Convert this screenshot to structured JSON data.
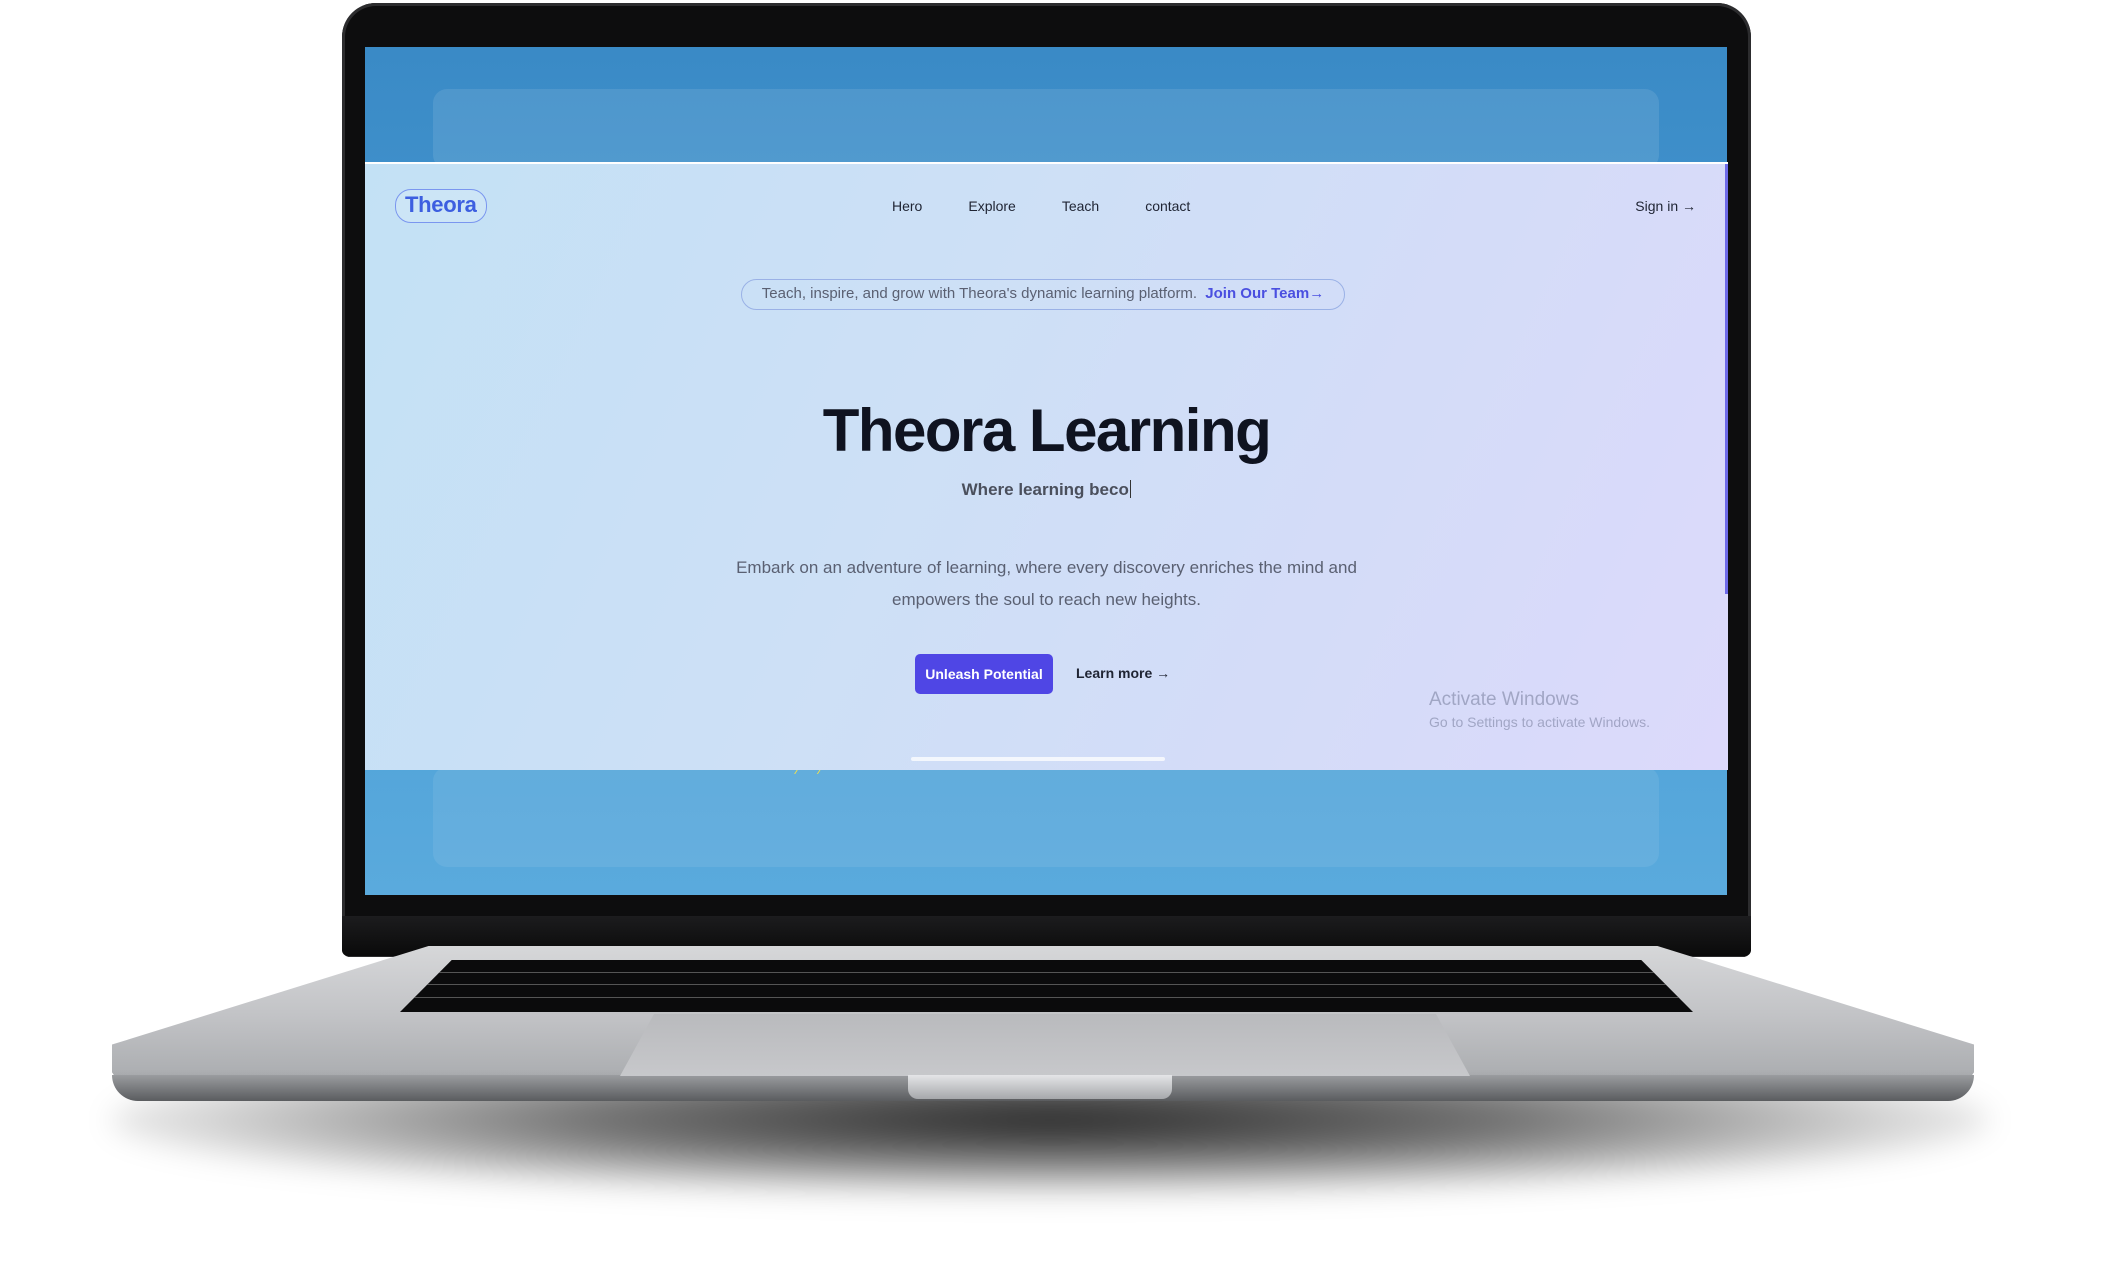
{
  "site": {
    "logo": "Theora",
    "nav": [
      "Hero",
      "Explore",
      "Teach",
      "contact"
    ],
    "sign_in": "Sign in →",
    "announcement": {
      "text": "Teach, inspire, and grow with Theora's dynamic learning platform.",
      "link": "Join Our Team→"
    },
    "title": "Theora Learning",
    "subtitle": "Where learning beco",
    "description_line1": "Embark on an adventure of learning, where every discovery enriches the mind and",
    "description_line2": "empowers the soul to reach new heights.",
    "primary_button": "Unleash Potential",
    "secondary_link": "Learn more →"
  },
  "os_watermark": {
    "line1": "Activate Windows",
    "line2": "Go to Settings to activate Windows."
  },
  "colors": {
    "accent": "#4f46e5",
    "logo": "#3d5fe0",
    "screen_bg": "#3a8ac6"
  }
}
